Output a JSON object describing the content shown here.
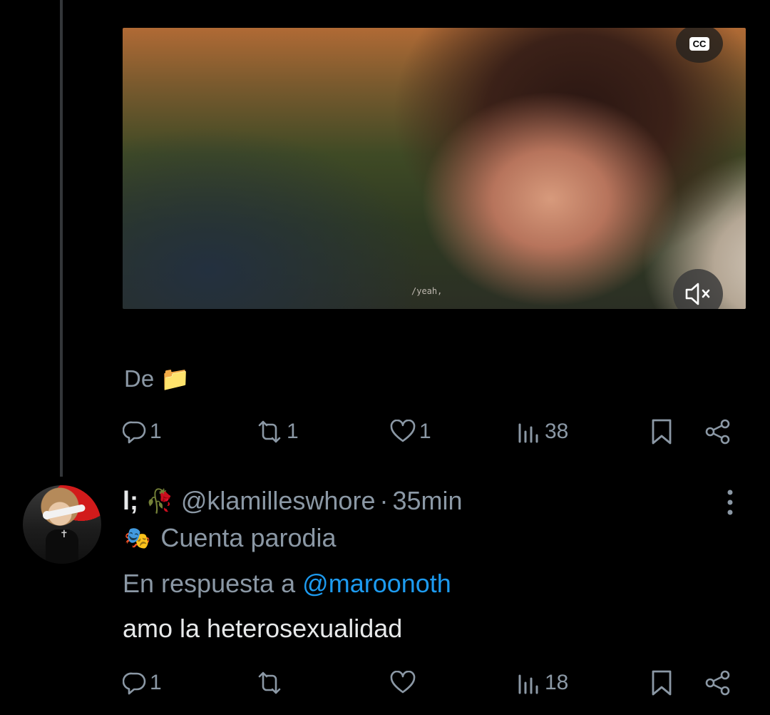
{
  "video": {
    "cc_label": "CC",
    "caption_overlay": "/yeah,"
  },
  "tweet": {
    "text": "De",
    "emoji": "📁",
    "stats": {
      "replies": "1",
      "retweets": "1",
      "likes": "1",
      "views": "38"
    }
  },
  "reply": {
    "display_name": "l;",
    "name_emoji": "🥀",
    "handle": "@klamilleswhore",
    "separator": "·",
    "time": "35min",
    "label_icon": "🎭",
    "label": "Cuenta parodia",
    "reply_prefix": "En respuesta a",
    "reply_mention": "@maroonoth",
    "text": "amo la heterosexualidad",
    "stats": {
      "replies": "1",
      "retweets": "",
      "likes": "",
      "views": "18"
    }
  },
  "colors": {
    "background": "#000000",
    "text": "#e7e9ea",
    "muted": "#8b98a5",
    "link": "#1d9bf0",
    "thread_line": "#333639"
  }
}
